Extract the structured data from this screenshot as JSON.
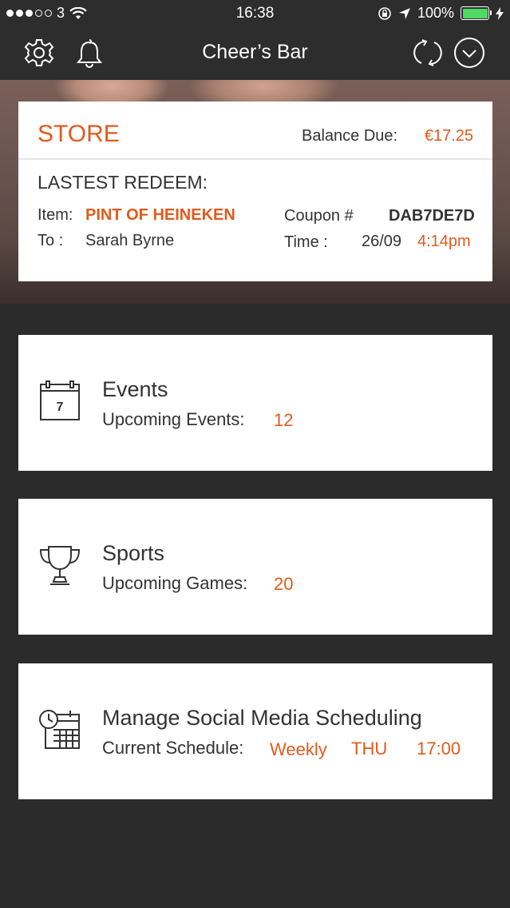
{
  "status_bar": {
    "carrier": "3",
    "time": "16:38",
    "battery_percent": "100%",
    "battery_level": 1.0
  },
  "nav": {
    "title": "Cheer’s Bar",
    "left_icons": [
      "gear-icon",
      "bell-icon"
    ],
    "right_icons": [
      "refresh-icon",
      "chevron-down-circle-icon"
    ]
  },
  "store": {
    "title": "STORE",
    "balance_label": "Balance Due:",
    "balance_value": "€17.25",
    "redeem_title": "LASTEST REDEEM:",
    "item_label": "Item:",
    "item_value": "PINT OF HEINEKEN",
    "to_label": "To :",
    "to_value": "Sarah Byrne",
    "coupon_label": "Coupon #",
    "coupon_value": "DAB7DE7D",
    "time_label": "Time :",
    "time_date": "26/09",
    "time_value": "4:14pm"
  },
  "cards": {
    "events": {
      "title": "Events",
      "sub_label": "Upcoming Events:",
      "count": "12",
      "icon": "calendar-icon",
      "icon_day": "7"
    },
    "sports": {
      "title": "Sports",
      "sub_label": "Upcoming Games:",
      "count": "20",
      "icon": "trophy-icon"
    },
    "social": {
      "title": "Manage Social Media Scheduling",
      "sub_label": "Current Schedule:",
      "frequency": "Weekly",
      "day": "THU",
      "time": "17:00",
      "icon": "schedule-calendar-icon"
    }
  },
  "colors": {
    "accent": "#e25a1c",
    "background": "#2b2b2b",
    "bar": "#2d2d2d",
    "battery": "#4cd964"
  }
}
